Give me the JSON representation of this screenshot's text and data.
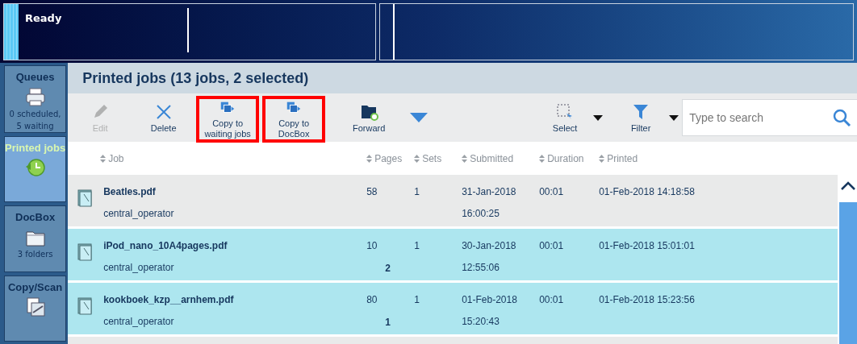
{
  "status_panel": {
    "text": "Ready"
  },
  "sidebar": {
    "items": [
      {
        "kind": "printer",
        "label": "Queues",
        "detail": "0 scheduled,\n5 waiting",
        "selected": false
      },
      {
        "kind": "history",
        "label": "Printed jobs",
        "selected": true
      },
      {
        "kind": "folder",
        "label": "DocBox",
        "detail": "3 folders",
        "selected": false
      },
      {
        "kind": "scanner",
        "label": "Copy/Scan",
        "selected": false
      }
    ]
  },
  "title": "Printed jobs (13 jobs, 2 selected)",
  "toolbar": {
    "buttons": [
      {
        "kind": "edit",
        "label": "Edit",
        "disabled": true,
        "highlighted": false
      },
      {
        "kind": "delete",
        "label": "Delete",
        "disabled": false,
        "highlighted": false
      },
      {
        "kind": "copy",
        "label": "Copy to\nwaiting jobs",
        "disabled": false,
        "highlighted": true
      },
      {
        "kind": "copy",
        "label": "Copy to\nDocBox",
        "disabled": false,
        "highlighted": true
      },
      {
        "kind": "forward",
        "label": "Forward",
        "disabled": false,
        "highlighted": false
      },
      {
        "kind": "more",
        "disabled": false,
        "highlighted": false
      },
      {
        "kind": "select",
        "label": "Select",
        "disabled": false,
        "highlighted": false
      },
      {
        "kind": "filter",
        "label": "Filter",
        "disabled": false,
        "highlighted": false
      }
    ],
    "search": {
      "placeholder": "Type to search"
    }
  },
  "table": {
    "columns": [
      "Job",
      "Pages",
      "Sets",
      "Submitted",
      "Duration",
      "Printed"
    ],
    "rows": [
      {
        "name": "Beatles.pdf",
        "owner": "central_operator",
        "pages": "58",
        "sets": "1",
        "submitted_date": "31-Jan-2018",
        "submitted_time": "16:00:25",
        "duration": "00:01",
        "printed": "01-Feb-2018 14:18:58",
        "selected": false
      },
      {
        "name": "iPod_nano_10A4pages.pdf",
        "owner": "central_operator",
        "order": "2",
        "pages": "10",
        "sets": "1",
        "submitted_date": "30-Jan-2018",
        "submitted_time": "12:55:06",
        "duration": "00:01",
        "printed": "01-Feb-2018 15:01:01",
        "selected": true
      },
      {
        "name": "kookboek_kzp__arnhem.pdf",
        "owner": "central_operator",
        "order": "1",
        "pages": "80",
        "sets": "1",
        "submitted_date": "01-Feb-2018",
        "submitted_time": "15:20:43",
        "duration": "00:01",
        "printed": "01-Feb-2018 15:23:56",
        "selected": true
      }
    ]
  }
}
